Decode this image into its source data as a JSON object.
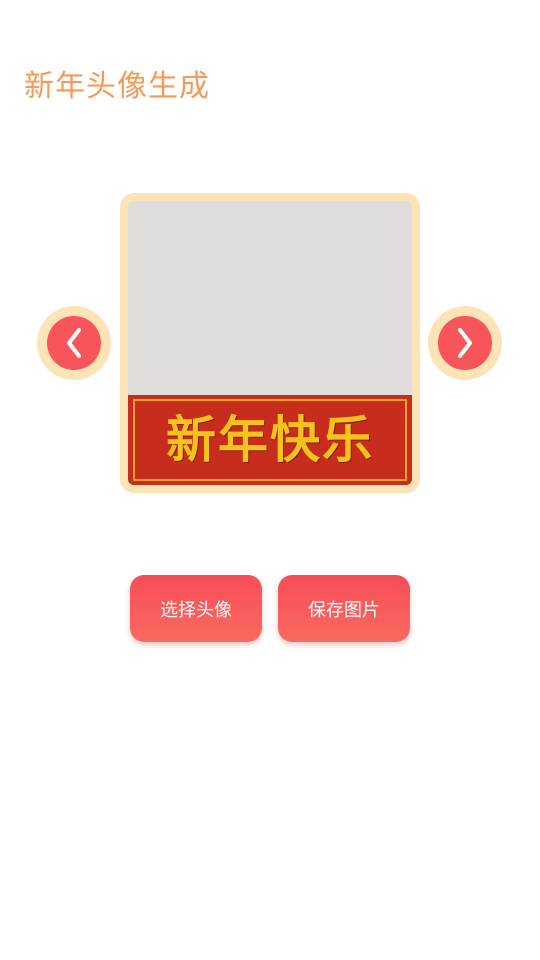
{
  "header": {
    "title": "新年头像生成"
  },
  "preview": {
    "banner_text": "新年快乐"
  },
  "controls": {
    "prev_icon": "chevron-left-icon",
    "next_icon": "chevron-right-icon"
  },
  "actions": {
    "choose_label": "选择头像",
    "save_label": "保存图片"
  },
  "colors": {
    "title": "#f79a57",
    "frame": "#fde4b6",
    "accent_red": "#f7555a",
    "banner_bg": "#c82c1c",
    "banner_text": "#f6c21c",
    "avatar_placeholder": "#e1dcdc"
  }
}
